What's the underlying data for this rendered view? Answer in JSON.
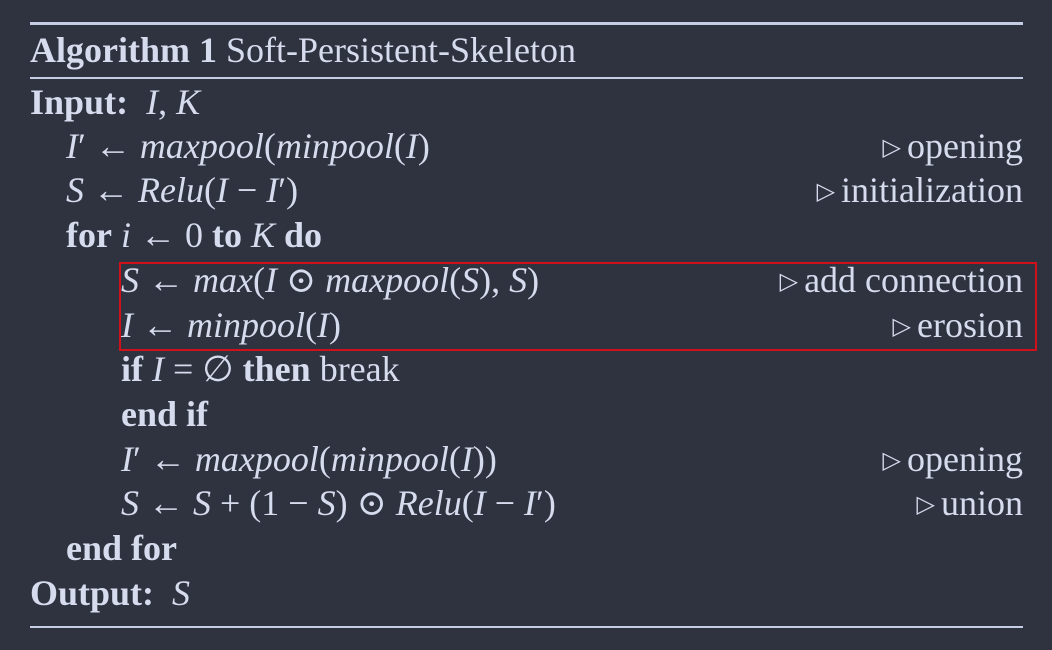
{
  "algorithm": {
    "label": "Algorithm 1",
    "name": "Soft-Persistent-Skeleton"
  },
  "lines": [
    {
      "indent": 0,
      "text": "Input: I, K",
      "comment": ""
    },
    {
      "indent": 1,
      "text": "I′ ← maxpool(minpool(I)",
      "comment": "opening"
    },
    {
      "indent": 1,
      "text": "S ← Relu(I − I′)",
      "comment": "initialization"
    },
    {
      "indent": 1,
      "text": "for i ← 0 to K do",
      "comment": ""
    },
    {
      "indent": 2,
      "text": "S ← max(I ⊙ maxpool(S), S)",
      "comment": "add connection"
    },
    {
      "indent": 2,
      "text": "I ← minpool(I)",
      "comment": "erosion"
    },
    {
      "indent": 2,
      "text": "if I = ∅ then break",
      "comment": ""
    },
    {
      "indent": 2,
      "text": "end if",
      "comment": ""
    },
    {
      "indent": 2,
      "text": "I′ ← maxpool(minpool(I))",
      "comment": "opening"
    },
    {
      "indent": 2,
      "text": "S ← S + (1 − S) ⊙ Relu(I − I′)",
      "comment": "union"
    },
    {
      "indent": 1,
      "text": "end for",
      "comment": ""
    },
    {
      "indent": 0,
      "text": "Output: S",
      "comment": ""
    }
  ],
  "comment_marker": "▷",
  "highlight": {
    "from_line": 4,
    "to_line": 5,
    "color": "#d0101a"
  },
  "colors": {
    "background": "#2f3340",
    "text": "#d6dcee",
    "rule": "#c5cde4",
    "highlight_border": "#d0101a"
  }
}
